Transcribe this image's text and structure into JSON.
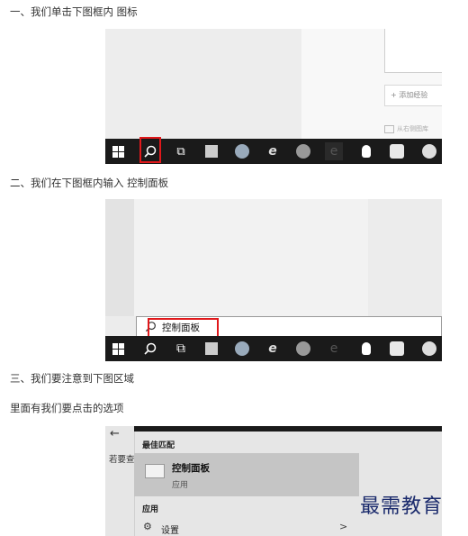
{
  "steps": {
    "s1": "一、我们单击下图框内 图标",
    "s2": "二、我们在下图框内输入 控制面板",
    "s3": "三、我们要注意到下图区域",
    "s4": "里面有我们要点击的选项"
  },
  "shot1": {
    "add_button": "+ 添加经验",
    "hint": "从右侧图库"
  },
  "shot2": {
    "search_text": "控制面板"
  },
  "shot3": {
    "cut_text": "若要查",
    "best_match": "最佳匹配",
    "result_title": "控制面板",
    "result_sub": "应用",
    "section_apps": "应用",
    "settings_label": "设置",
    "chevron": ">"
  },
  "watermark": "最需教育",
  "colors": {
    "taskbar": "#1a1a1a",
    "highlight_red": "#e0181b",
    "start_menu_bg": "#e6e6e6",
    "selected_item": "#c5c5c5"
  }
}
